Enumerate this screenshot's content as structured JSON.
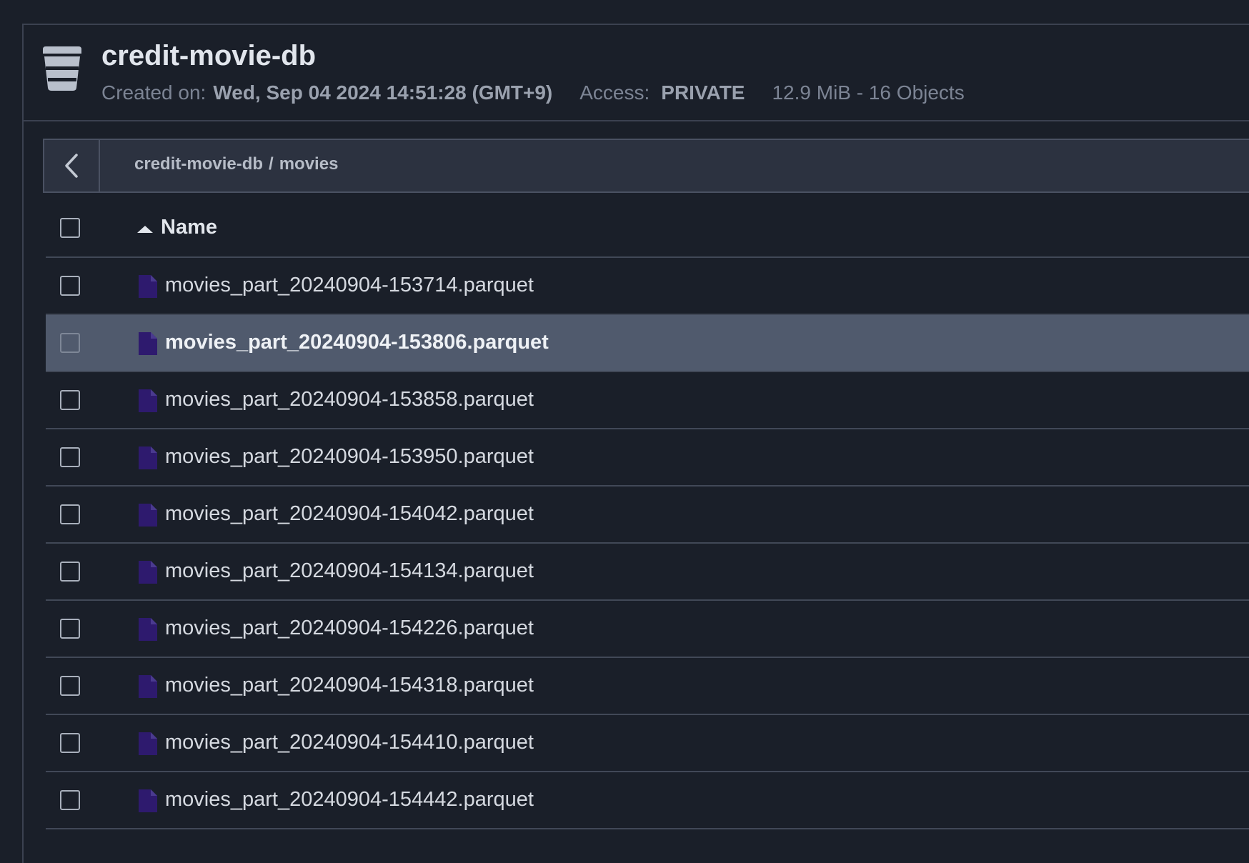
{
  "bucket": {
    "icon": "bucket-icon",
    "title": "credit-movie-db",
    "created_label": "Created on:",
    "created_value": "Wed, Sep 04 2024 14:51:28 (GMT+9)",
    "access_label": "Access:",
    "access_value": "PRIVATE",
    "size_summary": "12.9 MiB - 16 Objects"
  },
  "breadcrumb": {
    "back_icon": "chevron-left-icon",
    "root": "credit-movie-db",
    "separator": "/",
    "current": "movies"
  },
  "table": {
    "column_name": "Name",
    "sort_icon": "sort-ascending-icon",
    "file_icon": "file-icon",
    "file_icon_color": "#2e1a6e",
    "selected_row_color": "#505a6d",
    "rows": [
      {
        "name": "movies_part_20240904-153714.parquet",
        "selected": false
      },
      {
        "name": "movies_part_20240904-153806.parquet",
        "selected": true
      },
      {
        "name": "movies_part_20240904-153858.parquet",
        "selected": false
      },
      {
        "name": "movies_part_20240904-153950.parquet",
        "selected": false
      },
      {
        "name": "movies_part_20240904-154042.parquet",
        "selected": false
      },
      {
        "name": "movies_part_20240904-154134.parquet",
        "selected": false
      },
      {
        "name": "movies_part_20240904-154226.parquet",
        "selected": false
      },
      {
        "name": "movies_part_20240904-154318.parquet",
        "selected": false
      },
      {
        "name": "movies_part_20240904-154410.parquet",
        "selected": false
      },
      {
        "name": "movies_part_20240904-154442.parquet",
        "selected": false
      }
    ]
  }
}
